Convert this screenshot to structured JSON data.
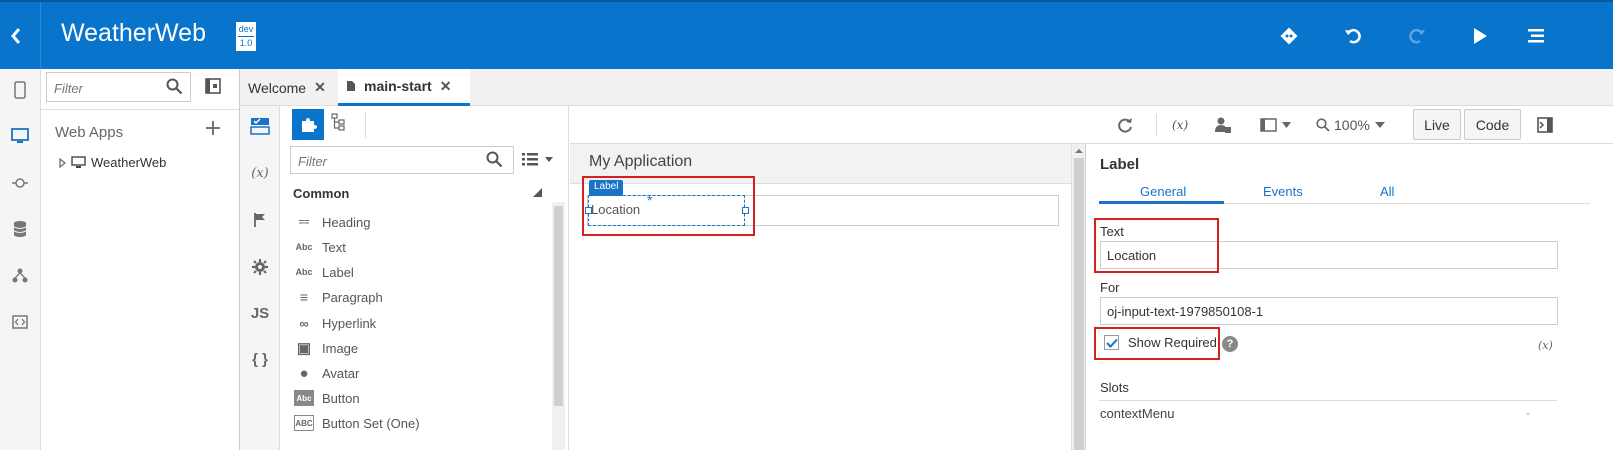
{
  "header": {
    "title": "WeatherWeb",
    "badge_top": "dev",
    "badge_bottom": "1.0",
    "icons": [
      "back-arrow-icon",
      "git-icon",
      "undo-icon",
      "redo-icon",
      "run-icon",
      "menu-icon"
    ]
  },
  "rail": {
    "icons": [
      "mobile-app-icon",
      "web-app-icon",
      "service-icon",
      "database-icon",
      "process-icon",
      "components-icon"
    ]
  },
  "project": {
    "filter_placeholder": "Filter",
    "section_title": "Web Apps",
    "tree_item": "WeatherWeb"
  },
  "tabs": [
    {
      "label": "Welcome",
      "active": false
    },
    {
      "label": "main-start",
      "active": true
    }
  ],
  "designer_icons": [
    "page-designer-icon",
    "variables-icon",
    "flag-icon",
    "settings-icon",
    "js-icon",
    "json-icon"
  ],
  "designer_labels": {
    "variables": "(x)",
    "js": "JS",
    "json": "{ }"
  },
  "palette": {
    "filter_placeholder": "Filter",
    "section": "Common",
    "items": [
      {
        "label": "Heading",
        "icon": "heading-icon",
        "glyph": "=="
      },
      {
        "label": "Text",
        "icon": "text-icon",
        "glyph": "Abc"
      },
      {
        "label": "Label",
        "icon": "label-icon",
        "glyph": "Abc"
      },
      {
        "label": "Paragraph",
        "icon": "paragraph-icon",
        "glyph": "≡"
      },
      {
        "label": "Hyperlink",
        "icon": "hyperlink-icon",
        "glyph": "∞"
      },
      {
        "label": "Image",
        "icon": "image-icon",
        "glyph": "▣"
      },
      {
        "label": "Avatar",
        "icon": "avatar-icon",
        "glyph": "●"
      },
      {
        "label": "Button",
        "icon": "button-icon",
        "glyph": "Abc"
      },
      {
        "label": "Button Set (One)",
        "icon": "button-set-icon",
        "glyph": "ABC"
      }
    ]
  },
  "toolbar": {
    "zoom": "100%",
    "live_label": "Live",
    "code_label": "Code",
    "fx_label": "(x)"
  },
  "canvas": {
    "title": "My Application",
    "tag": "Label",
    "label_text": "Location",
    "required_mark": "*"
  },
  "properties": {
    "title": "Label",
    "tabs": [
      "General",
      "Events",
      "All"
    ],
    "active_tab": "General",
    "text_label": "Text",
    "text_value": "Location",
    "for_label": "For",
    "for_value": "oj-input-text-1979850108-1",
    "show_required_label": "Show Required",
    "show_required_checked": true,
    "help_glyph": "?",
    "fx_label": "(x)",
    "slots_title": "Slots",
    "slot_item": "contextMenu",
    "slot_value": "-"
  },
  "colors": {
    "header_bg": "#0874cc",
    "accent": "#1a73c8",
    "highlight": "#d62020"
  }
}
